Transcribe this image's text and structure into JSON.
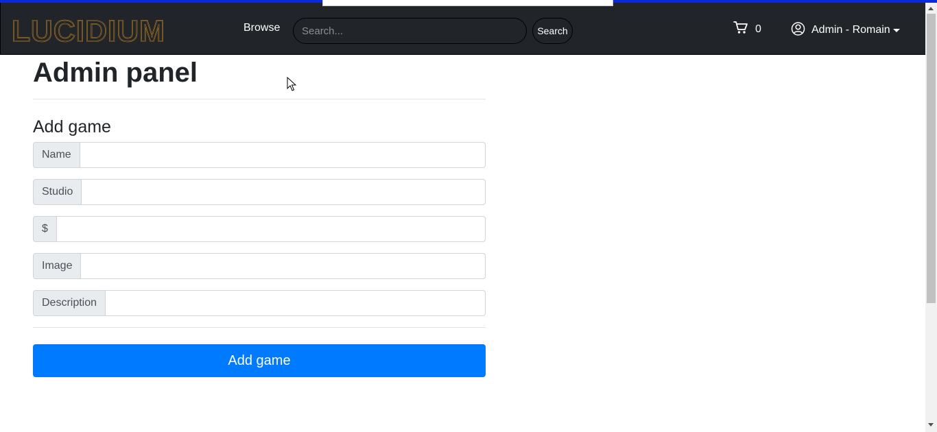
{
  "navbar": {
    "brand": "LUCIDIUM",
    "browse_label": "Browse",
    "search_placeholder": "Search...",
    "search_value": "",
    "search_button": "Search",
    "cart_icon": "cart-icon",
    "cart_count": "0",
    "user_icon": "user-circle-icon",
    "user_label": "Admin - Romain"
  },
  "main": {
    "title": "Admin panel",
    "section_title": "Add game",
    "fields": [
      {
        "label": "Name",
        "value": ""
      },
      {
        "label": "Studio",
        "value": ""
      },
      {
        "label": "$",
        "value": ""
      },
      {
        "label": "Image",
        "value": ""
      },
      {
        "label": "Description",
        "value": ""
      }
    ],
    "submit_label": "Add game"
  },
  "colors": {
    "navbar_bg": "#212529",
    "brand_orange": "#f0a01e",
    "primary": "#007bff",
    "addon_bg": "#e9ecef",
    "top_strip": "#0a2bd6"
  }
}
